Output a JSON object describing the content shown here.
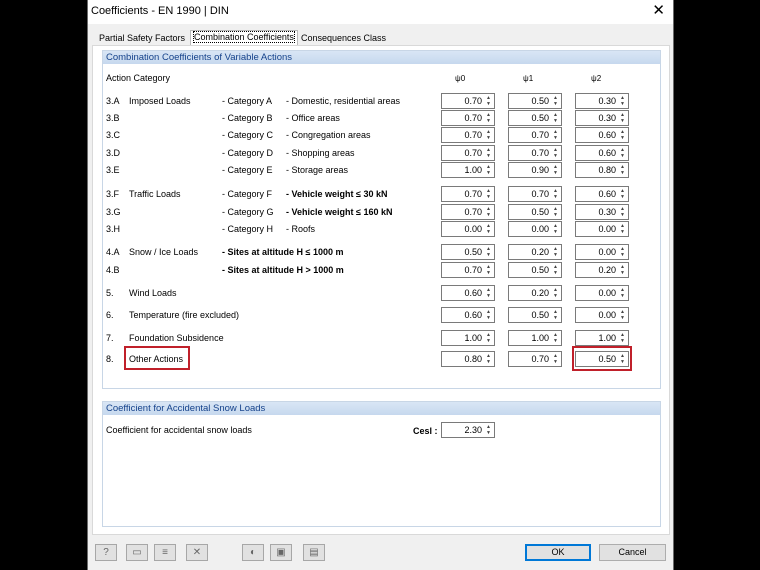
{
  "window": {
    "title": "Coefficients - EN 1990 | DIN"
  },
  "tabs": [
    "Partial Safety Factors",
    "Combination Coefficients",
    "Consequences Class"
  ],
  "combination": {
    "title": "Combination Coefficients of Variable Actions",
    "action_category_label": "Action Category",
    "psi_headers": [
      "ψ0",
      "ψ1",
      "ψ2"
    ]
  },
  "rows": [
    {
      "id": "3.A",
      "group": "Imposed Loads",
      "cat": "- Category A",
      "desc": "- Domestic, residential areas",
      "psi0": "0.70",
      "psi1": "0.50",
      "psi2": "0.30"
    },
    {
      "id": "3.B",
      "group": "",
      "cat": "- Category B",
      "desc": "- Office areas",
      "psi0": "0.70",
      "psi1": "0.50",
      "psi2": "0.30"
    },
    {
      "id": "3.C",
      "group": "",
      "cat": "- Category C",
      "desc": "- Congregation areas",
      "psi0": "0.70",
      "psi1": "0.70",
      "psi2": "0.60"
    },
    {
      "id": "3.D",
      "group": "",
      "cat": "- Category D",
      "desc": "- Shopping areas",
      "psi0": "0.70",
      "psi1": "0.70",
      "psi2": "0.60"
    },
    {
      "id": "3.E",
      "group": "",
      "cat": "- Category E",
      "desc": "- Storage areas",
      "psi0": "1.00",
      "psi1": "0.90",
      "psi2": "0.80"
    },
    {
      "id": "3.F",
      "group": "Traffic Loads",
      "cat": "- Category F",
      "desc": "- Vehicle weight ≤ 30 kN",
      "psi0": "0.70",
      "psi1": "0.70",
      "psi2": "0.60"
    },
    {
      "id": "3.G",
      "group": "",
      "cat": "- Category G",
      "desc": "- Vehicle weight ≤ 160 kN",
      "psi0": "0.70",
      "psi1": "0.50",
      "psi2": "0.30"
    },
    {
      "id": "3.H",
      "group": "",
      "cat": "- Category H",
      "desc": "- Roofs",
      "psi0": "0.00",
      "psi1": "0.00",
      "psi2": "0.00"
    },
    {
      "id": "4.A",
      "group": "Snow / Ice Loads",
      "cat": "- Sites at altitude H ≤ 1000 m",
      "desc": "",
      "psi0": "0.50",
      "psi1": "0.20",
      "psi2": "0.00"
    },
    {
      "id": "4.B",
      "group": "",
      "cat": "- Sites at altitude H > 1000 m",
      "desc": "",
      "psi0": "0.70",
      "psi1": "0.50",
      "psi2": "0.20"
    },
    {
      "id": "5.",
      "group": "Wind Loads",
      "cat": "",
      "desc": "",
      "psi0": "0.60",
      "psi1": "0.20",
      "psi2": "0.00"
    },
    {
      "id": "6.",
      "group": "Temperature (fire excluded)",
      "cat": "",
      "desc": "",
      "psi0": "0.60",
      "psi1": "0.50",
      "psi2": "0.00"
    },
    {
      "id": "7.",
      "group": "Foundation Subsidence",
      "cat": "",
      "desc": "",
      "psi0": "1.00",
      "psi1": "1.00",
      "psi2": "1.00"
    },
    {
      "id": "8.",
      "group": "Other Actions",
      "cat": "",
      "desc": "",
      "psi0": "0.80",
      "psi1": "0.70",
      "psi2": "0.50"
    }
  ],
  "snow": {
    "title": "Coefficient for Accidental Snow Loads",
    "label": "Coefficient for accidental snow loads",
    "symbol": "Cesl :",
    "value": "2.30"
  },
  "buttons": {
    "ok": "OK",
    "cancel": "Cancel"
  },
  "toolbar_icons": [
    "help-icon",
    "new-icon",
    "edit-icon",
    "delete-icon",
    "import-icon",
    "save-icon",
    "export-icon"
  ],
  "colors": {
    "highlight": "#c0202a",
    "group_header": "#c6d8ee",
    "group_title_text": "#15428b"
  }
}
